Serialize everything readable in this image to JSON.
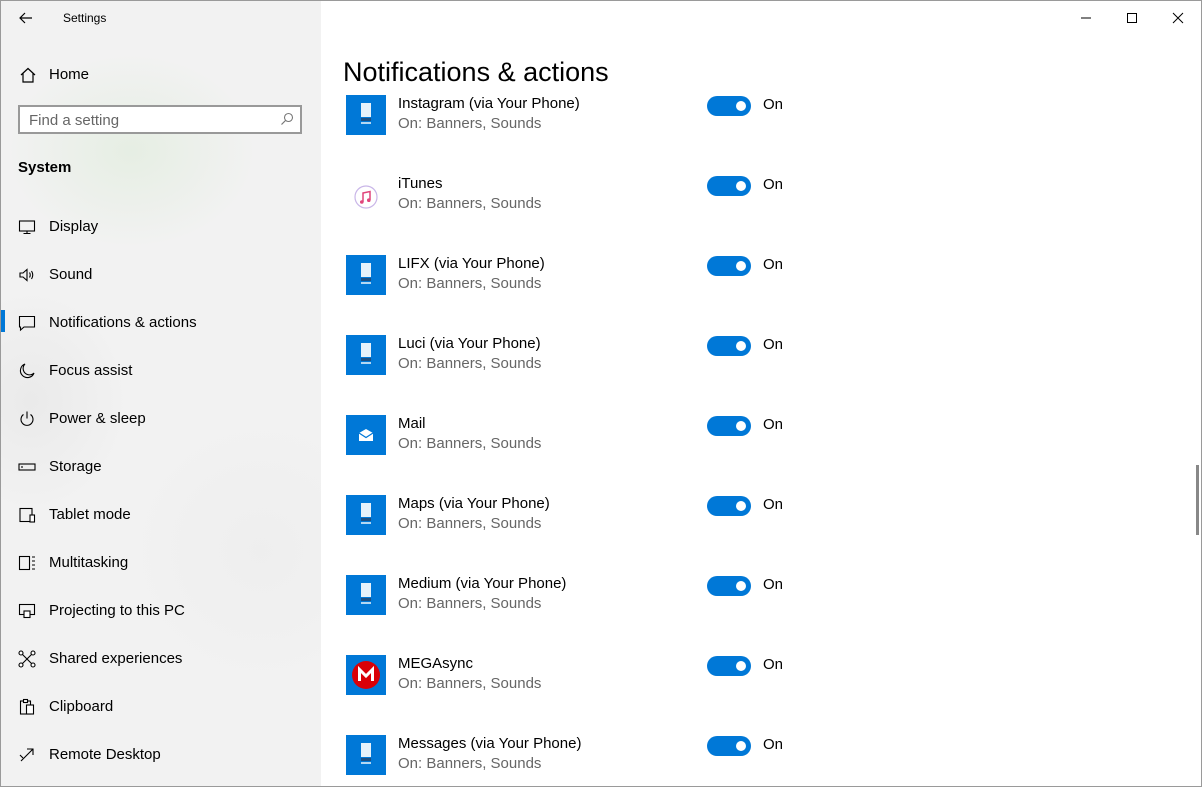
{
  "window": {
    "title": "Settings"
  },
  "sidebar": {
    "home_label": "Home",
    "search_placeholder": "Find a setting",
    "section_title": "System",
    "items": [
      {
        "label": "Display",
        "icon": "monitor-icon"
      },
      {
        "label": "Sound",
        "icon": "speaker-icon"
      },
      {
        "label": "Notifications & actions",
        "icon": "notification-icon",
        "selected": true
      },
      {
        "label": "Focus assist",
        "icon": "moon-icon"
      },
      {
        "label": "Power & sleep",
        "icon": "power-icon"
      },
      {
        "label": "Storage",
        "icon": "storage-icon"
      },
      {
        "label": "Tablet mode",
        "icon": "tablet-icon"
      },
      {
        "label": "Multitasking",
        "icon": "multitasking-icon"
      },
      {
        "label": "Projecting to this PC",
        "icon": "projecting-icon"
      },
      {
        "label": "Shared experiences",
        "icon": "shared-experiences-icon"
      },
      {
        "label": "Clipboard",
        "icon": "clipboard-icon"
      },
      {
        "label": "Remote Desktop",
        "icon": "remote-desktop-icon"
      }
    ]
  },
  "main": {
    "page_title": "Notifications & actions",
    "apps": [
      {
        "name": "Instagram (via Your Phone)",
        "status": "On: Banners, Sounds",
        "toggle": "On",
        "icon": "your-phone-icon"
      },
      {
        "name": "iTunes",
        "status": "On: Banners, Sounds",
        "toggle": "On",
        "icon": "itunes-icon"
      },
      {
        "name": "LIFX (via Your Phone)",
        "status": "On: Banners, Sounds",
        "toggle": "On",
        "icon": "your-phone-icon"
      },
      {
        "name": "Luci (via Your Phone)",
        "status": "On: Banners, Sounds",
        "toggle": "On",
        "icon": "your-phone-icon"
      },
      {
        "name": "Mail",
        "status": "On: Banners, Sounds",
        "toggle": "On",
        "icon": "mail-icon"
      },
      {
        "name": "Maps (via Your Phone)",
        "status": "On: Banners, Sounds",
        "toggle": "On",
        "icon": "your-phone-icon"
      },
      {
        "name": "Medium (via Your Phone)",
        "status": "On: Banners, Sounds",
        "toggle": "On",
        "icon": "your-phone-icon"
      },
      {
        "name": "MEGAsync",
        "status": "On: Banners, Sounds",
        "toggle": "On",
        "icon": "megasync-icon"
      },
      {
        "name": "Messages (via Your Phone)",
        "status": "On: Banners, Sounds",
        "toggle": "On",
        "icon": "your-phone-icon"
      }
    ]
  },
  "colors": {
    "accent": "#0078d7",
    "mega_red": "#d90007",
    "sidebar_bg": "#f2f2f2"
  }
}
